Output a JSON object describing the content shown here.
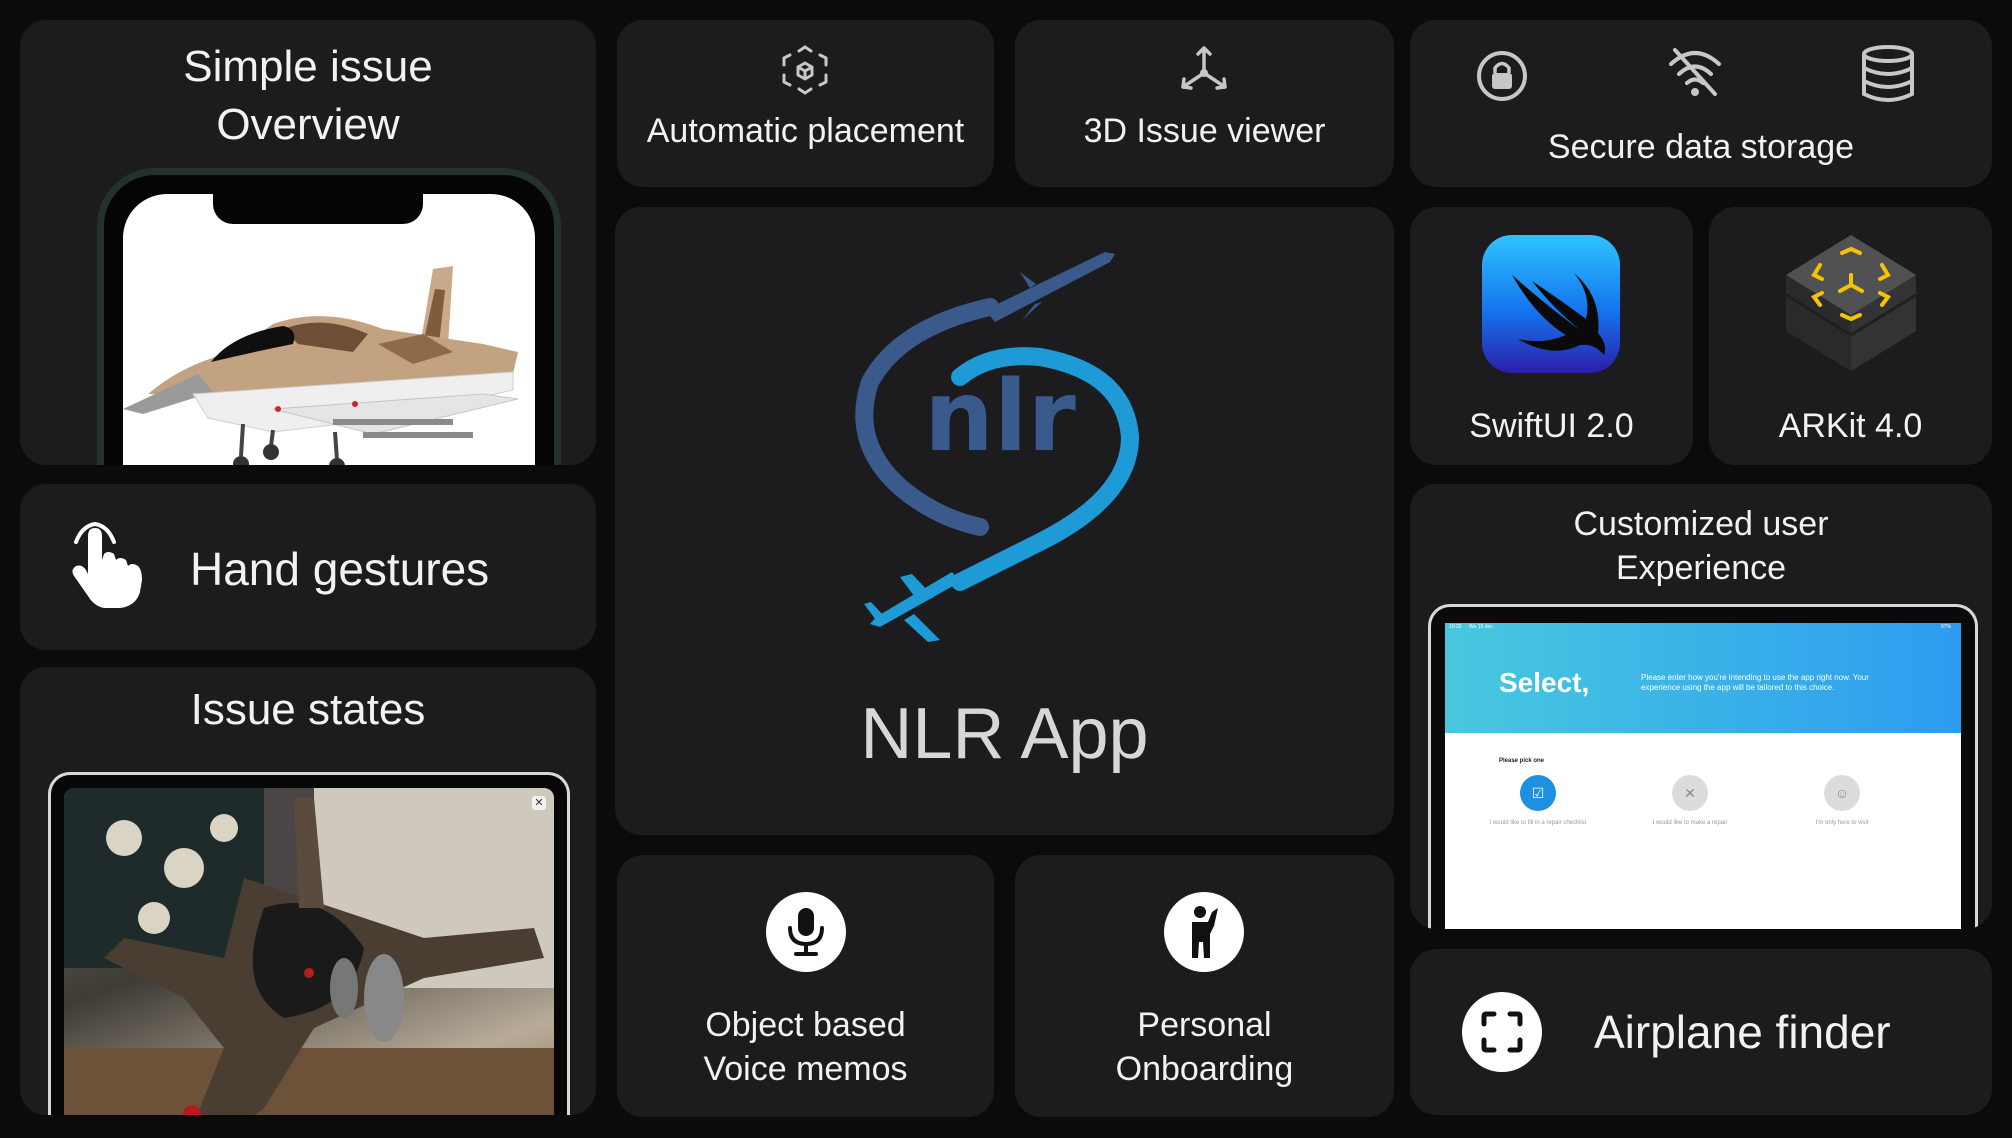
{
  "app_title": "NLR App",
  "cards": {
    "simple_issue": {
      "title_line1": "Simple issue",
      "title_line2": "Overview"
    },
    "automatic_placement": {
      "label": "Automatic placement"
    },
    "issue_viewer": {
      "label": "3D Issue viewer"
    },
    "secure_storage": {
      "label": "Secure data storage"
    },
    "swiftui": {
      "label": "SwiftUI 2.0"
    },
    "arkit": {
      "label": "ARKit 4.0"
    },
    "hand_gestures": {
      "label": "Hand gestures"
    },
    "issue_states": {
      "label": "Issue states"
    },
    "customized_ux": {
      "title_line1": "Customized user",
      "title_line2": "Experience",
      "screen": {
        "status_time": "10:32",
        "status_date": "We 16 dec.",
        "status_battery": "97%",
        "heading": "Select,",
        "intro": "Please enter how you're intending to use the app right now. Your experience using the app will be tailored to this choice.",
        "pick_label": "Please pick one",
        "options": [
          {
            "label": "I would like to fill in a repair checklist"
          },
          {
            "label": "I would like to make a repair"
          },
          {
            "label": "I'm only here to visit"
          }
        ]
      }
    },
    "voice_memos": {
      "line1": "Object based",
      "line2": "Voice memos"
    },
    "onboarding": {
      "line1": "Personal",
      "line2": "Onboarding"
    },
    "airplane_finder": {
      "label": "Airplane finder"
    }
  },
  "logo": {
    "text": "nlr"
  },
  "colors": {
    "background": "#0b0b0c",
    "card": "#1c1c1e",
    "nlr_dark_blue": "#3a5a8c",
    "nlr_light_blue": "#1e9ad6",
    "ux_gradient_start": "#48c8df",
    "ux_gradient_end": "#2d9cf0",
    "arkit_yellow": "#f5c400"
  }
}
